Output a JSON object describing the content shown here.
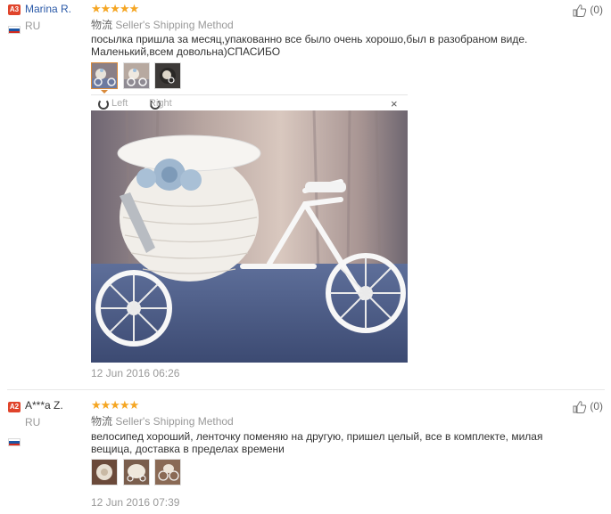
{
  "reviews": [
    {
      "level": "A3",
      "name": "Marina R.",
      "country": "RU",
      "stars": "★★★★★",
      "shipping_cn": "物流",
      "shipping": "Seller's Shipping Method",
      "text": "посылка пришла за месяц,упакованно все было очень хорошо,был в разобраном виде. Маленький,всем довольна)СПАСИБО",
      "helpful": "(0)",
      "date": "12 Jun 2016 06:26",
      "viewer": {
        "left": "Left",
        "right": "Right",
        "close": "×"
      }
    },
    {
      "level": "A2",
      "name": "A***a Z.",
      "country": "RU",
      "stars": "★★★★★",
      "shipping_cn": "物流",
      "shipping": "Seller's Shipping Method",
      "text": "велосипед хороший, ленточку поменяю на другую, пришел целый, все в комплекте, милая вещица, доставка в пределах времени",
      "helpful": "(0)",
      "date": "12 Jun 2016 07:39"
    }
  ],
  "colors": {
    "star": "#f5a623",
    "badge": "#e0442b",
    "link_blue": "#2b5aa8",
    "active_thumb": "#d98a3a"
  }
}
